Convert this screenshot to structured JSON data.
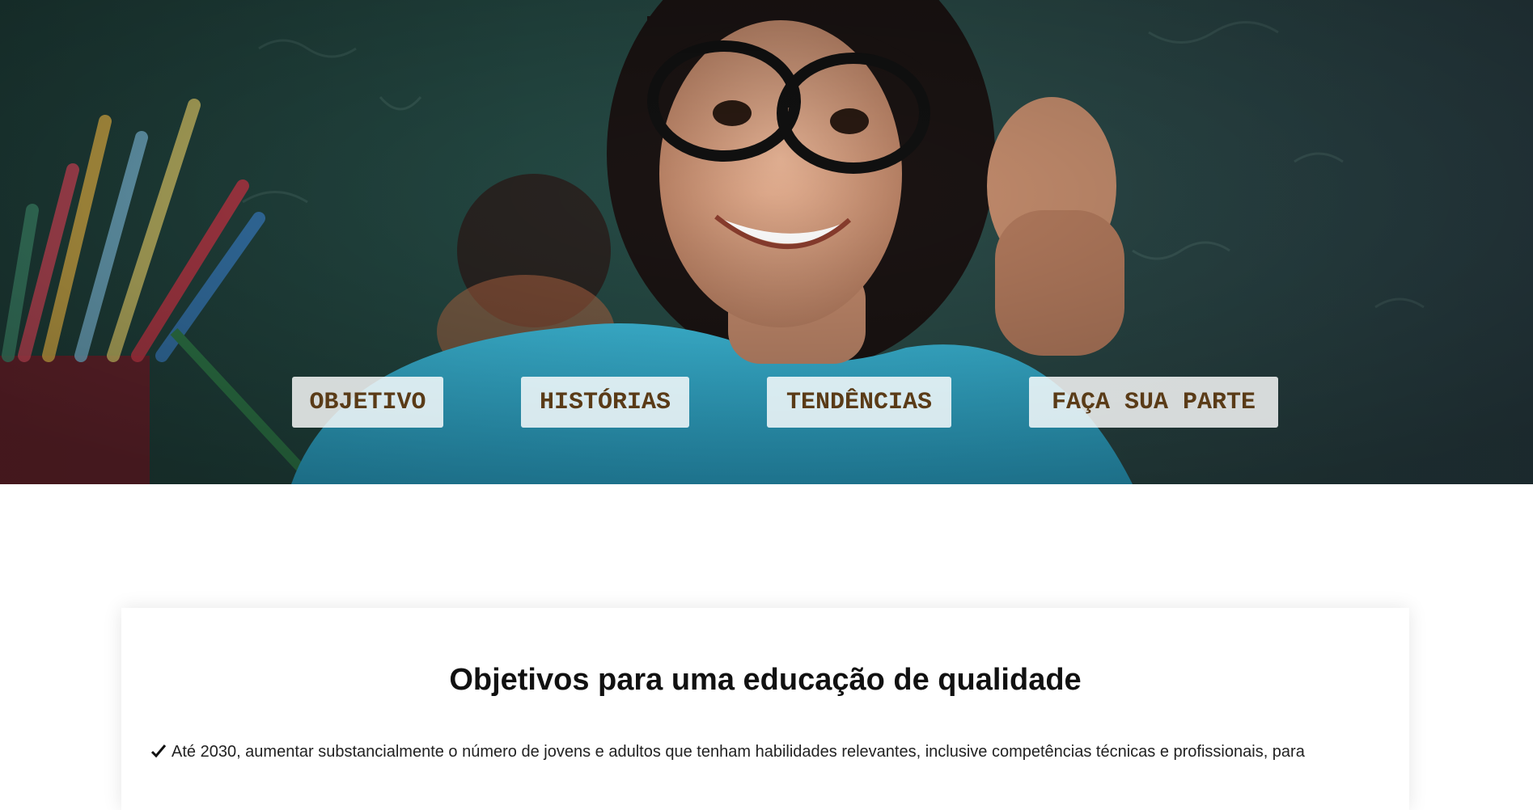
{
  "nav": {
    "items": [
      {
        "label": "OBJETIVO"
      },
      {
        "label": "HISTÓRIAS"
      },
      {
        "label": "TENDÊNCIAS"
      },
      {
        "label": "FAÇA SUA PARTE"
      }
    ]
  },
  "section": {
    "title": "Objetivos para uma educação de qualidade",
    "goals": [
      {
        "text": "Até 2030, aumentar substancialmente o número de jovens e adultos que tenham habilidades relevantes, inclusive competências técnicas e profissionais, para"
      }
    ]
  },
  "colors": {
    "nav_text": "#5a3b17",
    "nav_bg": "rgba(255,255,255,0.82)",
    "shirt": "#38b6d6",
    "chalkboard": "#254b45"
  }
}
